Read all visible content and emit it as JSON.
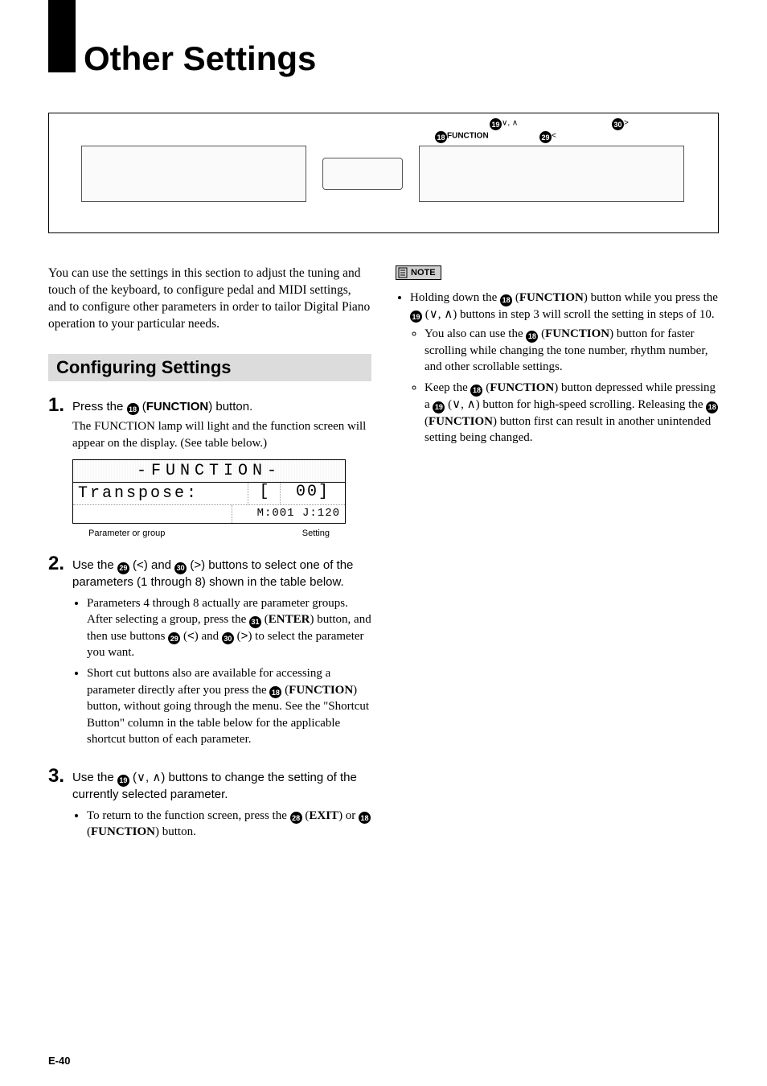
{
  "page_title": "Other Settings",
  "device_labels": {
    "function_marker": "⓲FUNCTION",
    "marker_19": "⓳∨, ∧",
    "marker_29": "㉙＜",
    "marker_30": "㉚＞"
  },
  "intro": "You can use the settings in this section to adjust the tuning and touch of the keyboard, to configure pedal and MIDI settings, and to configure other parameters in order to tailor Digital Piano operation to your particular needs.",
  "section_heading": "Configuring Settings",
  "steps": {
    "s1": {
      "num": "1.",
      "line_pre": "Press the ",
      "ref": "18",
      "line_post": " (",
      "func": "FUNCTION",
      "line_end": ") button.",
      "detail": "The FUNCTION lamp will light and the function screen will appear on the display. (See table below.)"
    },
    "s2": {
      "num": "2.",
      "line": "Use the ㉙ (＜) and ㉚ (＞) buttons to select one of the parameters (1 through 8) shown in the table below.",
      "b1": "Parameters 4 through 8 actually are parameter groups. After selecting a group, press the ㉛ (ENTER) button, and then use buttons ㉙ (＜) and ㉚ (＞) to select the parameter you want.",
      "b2": "Short cut buttons also are available for accessing a parameter directly after you press the ⓲ (FUNCTION) button, without going through the menu. See the \"Shortcut Button\" column in the table below for the applicable shortcut button of each parameter."
    },
    "s3": {
      "num": "3.",
      "line": "Use the ⓳ (∨, ∧) buttons to change the setting of the currently selected parameter.",
      "b1": "To return to the function screen, press the ㉘ (EXIT) or ⓲ (FUNCTION) button."
    }
  },
  "lcd": {
    "top": "-FUNCTION-",
    "mid_l": "Transpose:",
    "mid_m": "[",
    "mid_r": "00]",
    "bot_r": "M:001 J:120",
    "label_l": "Parameter or group",
    "label_r": "Setting"
  },
  "note": {
    "tag": "NOTE",
    "b1": "Holding down the ⓲ (FUNCTION) button while you press the ⓳ (∨, ∧) buttons in step 3 will scroll the setting in steps of 10.",
    "b1a": "You also can use the ⓲ (FUNCTION) button for faster scrolling while changing the tone number, rhythm number, and other scrollable settings.",
    "b1b": "Keep the ⓲ (FUNCTION) button depressed while pressing a ⓳ (∨, ∧) button for high-speed scrolling. Releasing the ⓲ (FUNCTION) button first can result in another unintended setting being changed."
  },
  "page_number": "E-40"
}
